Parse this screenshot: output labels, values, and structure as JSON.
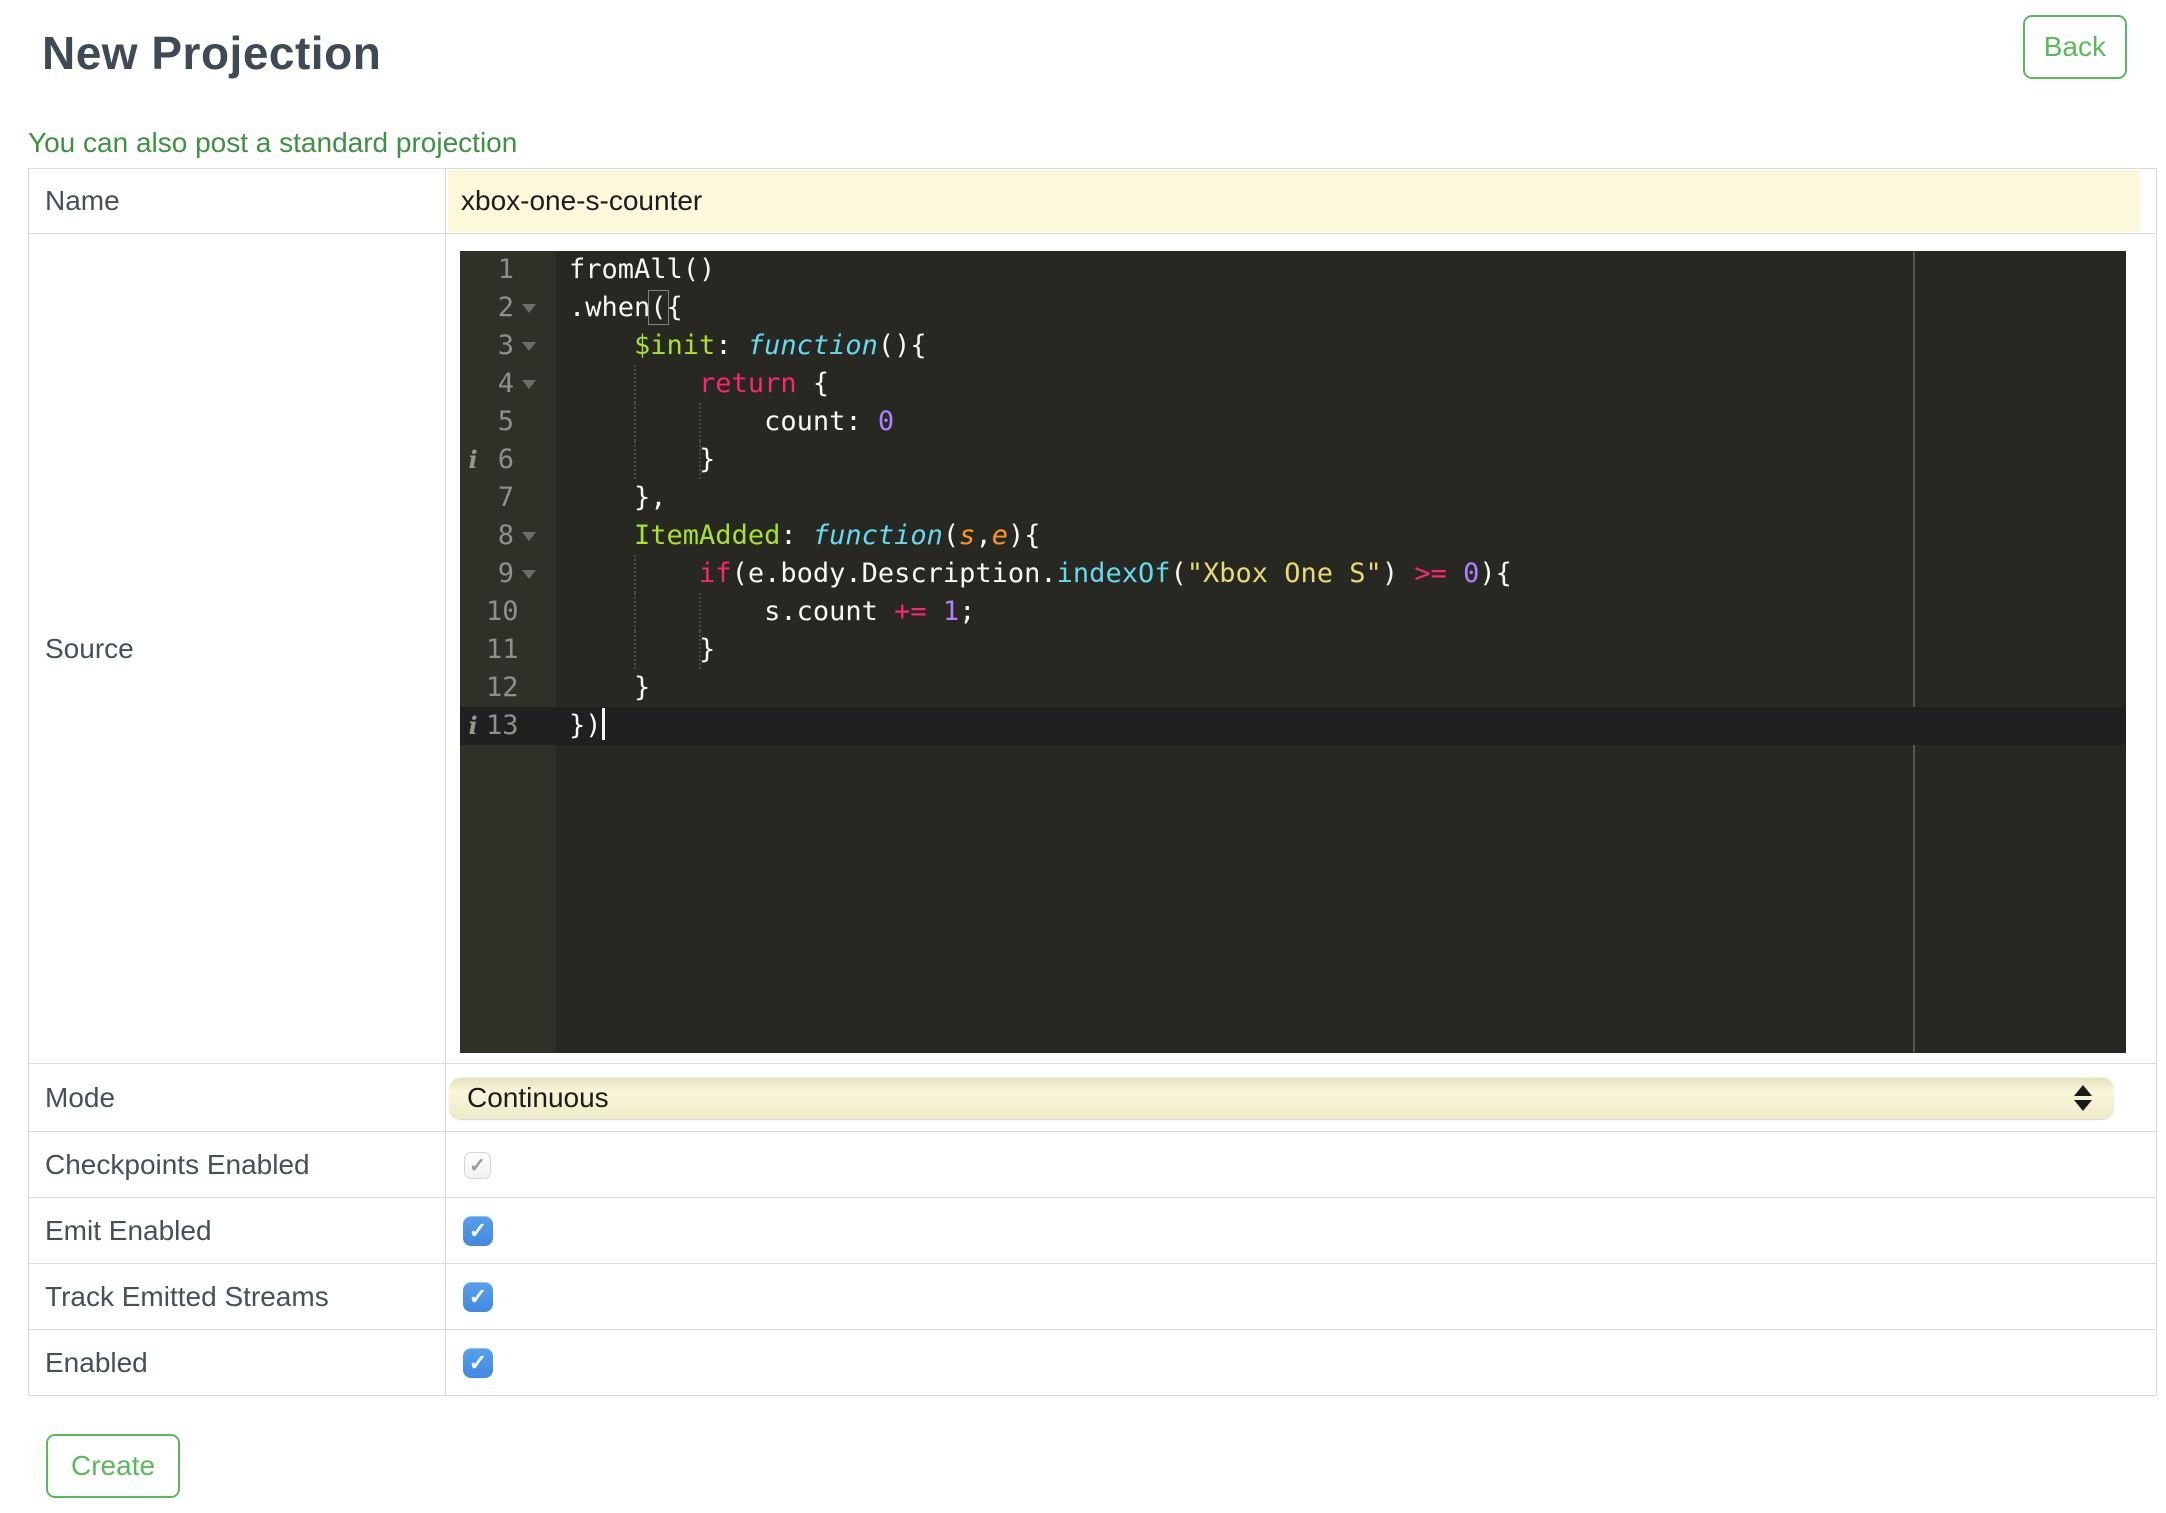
{
  "header": {
    "title": "New Projection",
    "back_label": "Back"
  },
  "link": {
    "standard_projection": "You can also post a standard projection"
  },
  "form": {
    "rows": [
      {
        "label": "Name",
        "type": "input",
        "value": "xbox-one-s-counter"
      },
      {
        "label": "Source",
        "type": "editor"
      },
      {
        "label": "Mode",
        "type": "select",
        "value": "Continuous"
      },
      {
        "label": "Checkpoints Enabled",
        "type": "checkbox",
        "checkbox": {
          "checked": true,
          "disabled": true
        }
      },
      {
        "label": "Emit Enabled",
        "type": "checkbox",
        "checkbox": {
          "checked": true,
          "disabled": false
        }
      },
      {
        "label": "Track Emitted Streams",
        "type": "checkbox",
        "checkbox": {
          "checked": true,
          "disabled": false
        }
      },
      {
        "label": "Enabled",
        "type": "checkbox",
        "checkbox": {
          "checked": true,
          "disabled": false
        }
      }
    ],
    "create_label": "Create",
    "check_glyph": "✓"
  },
  "editor": {
    "info_glyph": "i",
    "lines": [
      {
        "n": 1,
        "tokens": [
          {
            "t": "fromAll()",
            "c": "plain"
          }
        ]
      },
      {
        "n": 2,
        "fold": true,
        "tokens": [
          {
            "t": ".when",
            "c": "plain"
          },
          {
            "t": "(",
            "c": "bracket"
          },
          {
            "t": "{",
            "c": "plain"
          }
        ]
      },
      {
        "n": 3,
        "fold": true,
        "tokens": [
          {
            "t": "    ",
            "c": "plain"
          },
          {
            "t": "$init",
            "c": "green"
          },
          {
            "t": ": ",
            "c": "plain"
          },
          {
            "t": "function",
            "c": "cyani"
          },
          {
            "t": "(){",
            "c": "plain"
          }
        ]
      },
      {
        "n": 4,
        "fold": true,
        "guides": [
          1
        ],
        "tokens": [
          {
            "t": "        ",
            "c": "plain"
          },
          {
            "t": "return",
            "c": "pink"
          },
          {
            "t": " {",
            "c": "plain"
          }
        ]
      },
      {
        "n": 5,
        "guides": [
          1,
          2
        ],
        "tokens": [
          {
            "t": "            count: ",
            "c": "plain"
          },
          {
            "t": "0",
            "c": "purple"
          }
        ]
      },
      {
        "n": 6,
        "info": true,
        "guides": [
          1,
          2
        ],
        "tokens": [
          {
            "t": "        }",
            "c": "plain"
          }
        ]
      },
      {
        "n": 7,
        "tokens": [
          {
            "t": "    },",
            "c": "plain"
          }
        ]
      },
      {
        "n": 8,
        "fold": true,
        "tokens": [
          {
            "t": "    ",
            "c": "plain"
          },
          {
            "t": "ItemAdded",
            "c": "green"
          },
          {
            "t": ": ",
            "c": "plain"
          },
          {
            "t": "function",
            "c": "cyani"
          },
          {
            "t": "(",
            "c": "plain"
          },
          {
            "t": "s",
            "c": "orangei"
          },
          {
            "t": ",",
            "c": "plain"
          },
          {
            "t": "e",
            "c": "orangei"
          },
          {
            "t": "){",
            "c": "plain"
          }
        ]
      },
      {
        "n": 9,
        "fold": true,
        "guides": [
          1
        ],
        "tokens": [
          {
            "t": "        ",
            "c": "plain"
          },
          {
            "t": "if",
            "c": "pink"
          },
          {
            "t": "(e.body.Description.",
            "c": "plain"
          },
          {
            "t": "indexOf",
            "c": "cyan"
          },
          {
            "t": "(",
            "c": "plain"
          },
          {
            "t": "\"Xbox One S\"",
            "c": "yellow"
          },
          {
            "t": ") ",
            "c": "plain"
          },
          {
            "t": ">=",
            "c": "pink"
          },
          {
            "t": " ",
            "c": "plain"
          },
          {
            "t": "0",
            "c": "purple"
          },
          {
            "t": "){",
            "c": "plain"
          }
        ]
      },
      {
        "n": 10,
        "guides": [
          1,
          2
        ],
        "tokens": [
          {
            "t": "            s.count ",
            "c": "plain"
          },
          {
            "t": "+=",
            "c": "pink"
          },
          {
            "t": " ",
            "c": "plain"
          },
          {
            "t": "1",
            "c": "purple"
          },
          {
            "t": ";",
            "c": "plain"
          }
        ]
      },
      {
        "n": 11,
        "guides": [
          1,
          2
        ],
        "tokens": [
          {
            "t": "        }",
            "c": "plain"
          }
        ]
      },
      {
        "n": 12,
        "tokens": [
          {
            "t": "    }",
            "c": "plain"
          }
        ]
      },
      {
        "n": 13,
        "info": true,
        "active": true,
        "cursor": true,
        "tokens": [
          {
            "t": "})",
            "c": "plain"
          }
        ]
      }
    ]
  },
  "colors": {
    "accent_green": "#5CB85C",
    "link_green": "#3F9142",
    "heading": "#3E4A54",
    "label": "#455059",
    "value_text": "#1C1C1C",
    "table_border": "#D9D9D9",
    "input_yellow": "#FBF8DB",
    "checkbox_blue": "#4A92E6",
    "editor_bg": "#272822",
    "gutter_bg": "#2F3129",
    "gutter_text": "#8F908A",
    "active_line": "#202020",
    "print_margin": "#55564F",
    "code_plain": "#F8F8F2",
    "code_green": "#A6E22E",
    "code_cyan": "#66D9EF",
    "code_pink": "#F92672",
    "code_purple": "#AE81FF",
    "code_yellow": "#E6DB74",
    "code_orange": "#FD971F"
  }
}
